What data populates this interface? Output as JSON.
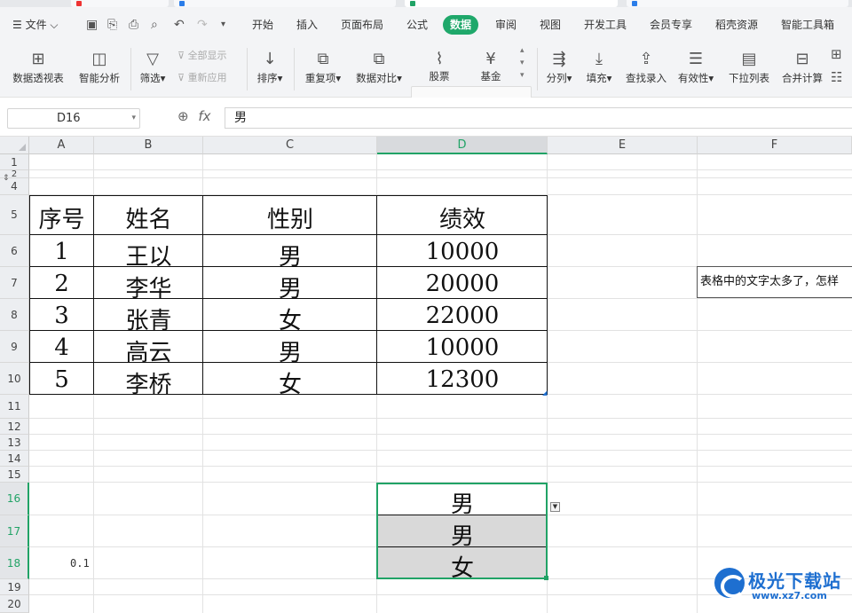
{
  "menu": {
    "file_label": "文件",
    "tabs": [
      "开始",
      "插入",
      "页面布局",
      "公式",
      "数据",
      "审阅",
      "视图",
      "开发工具",
      "会员专享",
      "稻壳资源",
      "智能工具箱"
    ],
    "active_tab": "数据"
  },
  "toolbar": {
    "pivot": "数据透视表",
    "smart_analysis": "智能分析",
    "filter": "筛选",
    "show_all": "全部显示",
    "reapply": "重新应用",
    "sort": "排序",
    "duplicates": "重复项",
    "compare": "数据对比",
    "stock": "股票",
    "fund": "基金",
    "split": "分列",
    "fill": "填充",
    "lookup": "查找录入",
    "validity": "有效性",
    "dropdown_list": "下拉列表",
    "merge_calc": "合并计算"
  },
  "formula_bar": {
    "cell_ref": "D16",
    "fx": "fx",
    "value": "男"
  },
  "columns": [
    "A",
    "B",
    "C",
    "D",
    "E",
    "F"
  ],
  "selected_column": "D",
  "rows": [
    "1",
    "2",
    "4",
    "5",
    "6",
    "7",
    "8",
    "9",
    "10",
    "11",
    "12",
    "13",
    "14",
    "15",
    "16",
    "17",
    "18",
    "19",
    "20"
  ],
  "table": {
    "headers": [
      "序号",
      "姓名",
      "性别",
      "绩效"
    ],
    "rows": [
      [
        "1",
        "王以",
        "男",
        "10000"
      ],
      [
        "2",
        "李华",
        "男",
        "20000"
      ],
      [
        "3",
        "张青",
        "女",
        "22000"
      ],
      [
        "4",
        "高云",
        "男",
        "10000"
      ],
      [
        "5",
        "李桥",
        "女",
        "12300"
      ]
    ]
  },
  "note_text": "表格中的文字太多了，怎样",
  "dropdown_cells": [
    "男",
    "男",
    "女"
  ],
  "cell_a18": "0.1",
  "watermark": {
    "name": "极光下载站",
    "url": "www.xz7.com"
  }
}
